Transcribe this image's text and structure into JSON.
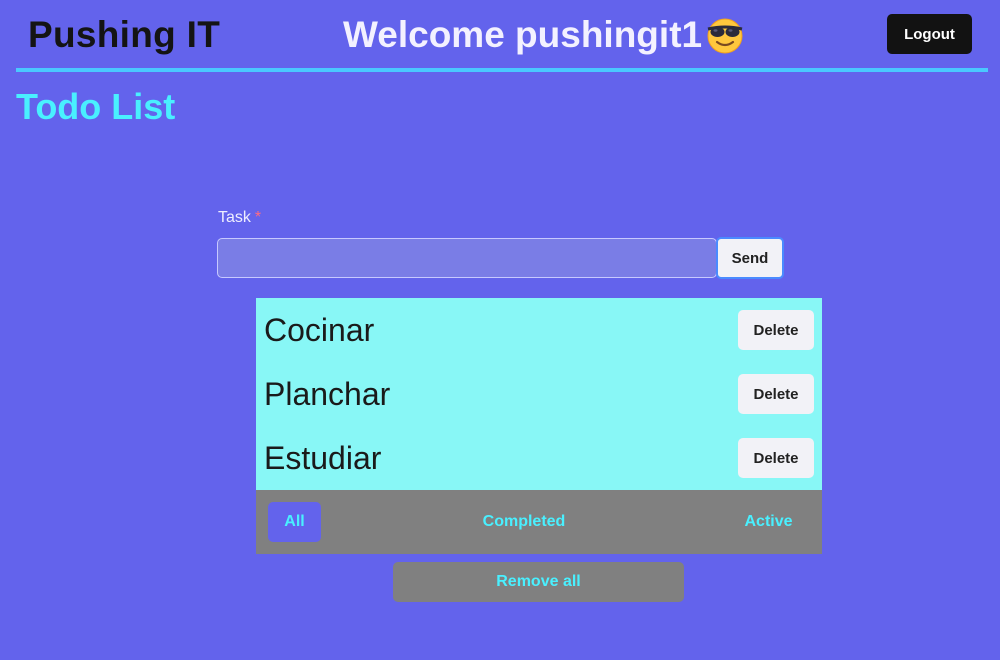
{
  "header": {
    "brand": "Pushing IT",
    "welcome": "Welcome pushingit1",
    "emoji_icon": "smiling-face-with-sunglasses-icon",
    "logout_label": "Logout"
  },
  "page": {
    "title": "Todo List"
  },
  "form": {
    "task_label": "Task",
    "required_marker": "*",
    "task_value": "",
    "send_label": "Send"
  },
  "todos": [
    {
      "text": "Cocinar",
      "delete_label": "Delete"
    },
    {
      "text": "Planchar",
      "delete_label": "Delete"
    },
    {
      "text": "Estudiar",
      "delete_label": "Delete"
    }
  ],
  "filters": {
    "all": "All",
    "completed": "Completed",
    "active": "Active",
    "selected": "All"
  },
  "remove_all_label": "Remove all",
  "colors": {
    "background": "#6363ec",
    "accent_cyan": "#49f0ff",
    "header_rule": "#4ac8ff",
    "list_background": "#88f7f6",
    "filter_bar": "#808080",
    "logout_button": "#121212"
  }
}
